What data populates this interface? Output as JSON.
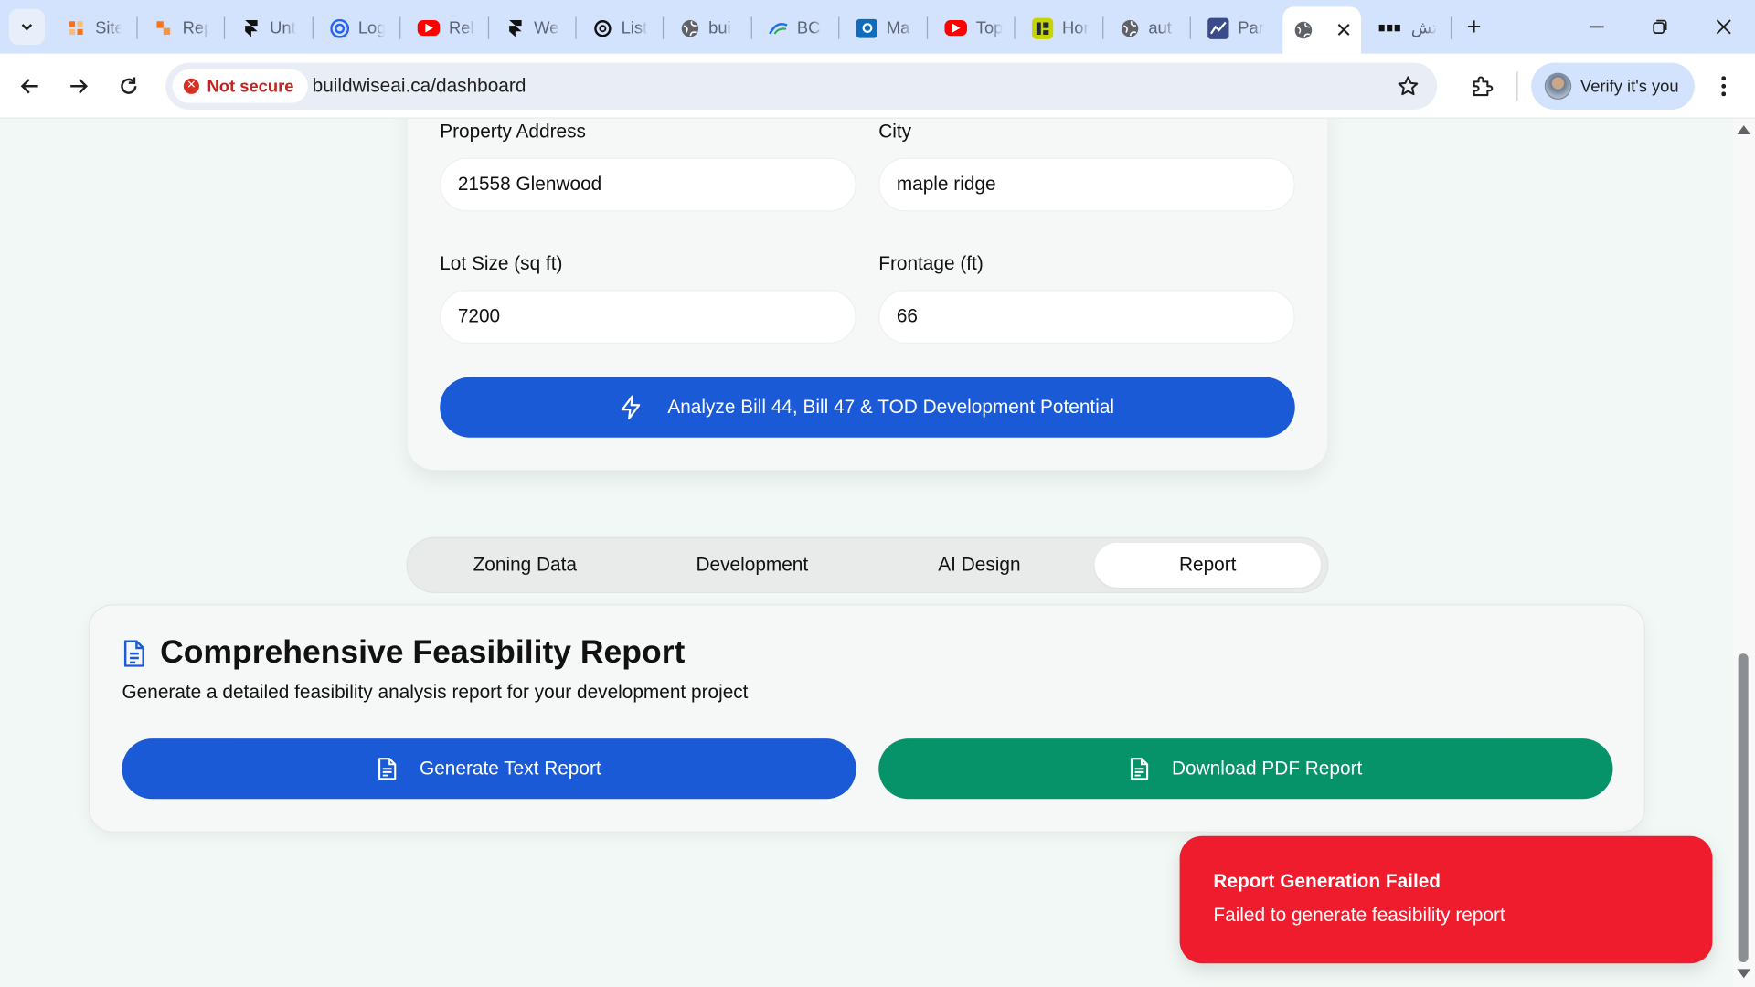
{
  "browser": {
    "tabs": [
      {
        "title": "Site",
        "favicon": "site-icon",
        "color": "#f97316"
      },
      {
        "title": "Rep",
        "favicon": "report-icon",
        "color": "#f97316"
      },
      {
        "title": "Unt",
        "favicon": "framer-icon",
        "color": "#111111"
      },
      {
        "title": "Log",
        "favicon": "spiral-icon",
        "color": "#2563eb"
      },
      {
        "title": "Rel",
        "favicon": "youtube-icon",
        "color": "#ff0000"
      },
      {
        "title": "We",
        "favicon": "framer-icon",
        "color": "#111111"
      },
      {
        "title": "List",
        "favicon": "openai-icon",
        "color": "#111111"
      },
      {
        "title": "bui",
        "favicon": "globe-icon",
        "color": "#5f6368"
      },
      {
        "title": "BC",
        "favicon": "bc-icon",
        "color": "#1a73e8"
      },
      {
        "title": "Ma",
        "favicon": "outlook-icon",
        "color": "#0f6cbd"
      },
      {
        "title": "Top",
        "favicon": "youtube-icon",
        "color": "#ff0000"
      },
      {
        "title": "Hor",
        "favicon": "grid-icon",
        "color": "#c7d400"
      },
      {
        "title": "aut",
        "favicon": "globe-icon",
        "color": "#5f6368"
      },
      {
        "title": "Par",
        "favicon": "chart-icon",
        "color": "#3b4b8a"
      },
      {
        "title": "",
        "favicon": "globe-icon",
        "color": "#5f6368",
        "active": true
      },
      {
        "title": "تش",
        "favicon": "dots-icon",
        "color": "#111111"
      }
    ],
    "security_label": "Not secure",
    "url": "buildwiseai.ca/dashboard",
    "profile_label": "Verify it's you"
  },
  "form": {
    "property_address_label": "Property Address",
    "property_address_value": "21558 Glenwood",
    "city_label": "City",
    "city_value": "maple ridge",
    "lot_size_label": "Lot Size (sq ft)",
    "lot_size_value": "7200",
    "frontage_label": "Frontage (ft)",
    "frontage_value": "66",
    "analyze_button": "Analyze Bill 44, Bill 47 & TOD Development Potential"
  },
  "tabs": {
    "items": [
      "Zoning Data",
      "Development",
      "AI Design",
      "Report"
    ],
    "active": "Report"
  },
  "report": {
    "title": "Comprehensive Feasibility Report",
    "subtitle": "Generate a detailed feasibility analysis report for your development project",
    "generate_button": "Generate Text Report",
    "download_button": "Download PDF Report"
  },
  "toast": {
    "title": "Report Generation Failed",
    "description": "Failed to generate feasibility report"
  },
  "colors": {
    "primary_blue": "#1a5ad6",
    "success_green": "#06936a",
    "error_red": "#ee1c2c",
    "page_bg": "#f2f8f5"
  }
}
